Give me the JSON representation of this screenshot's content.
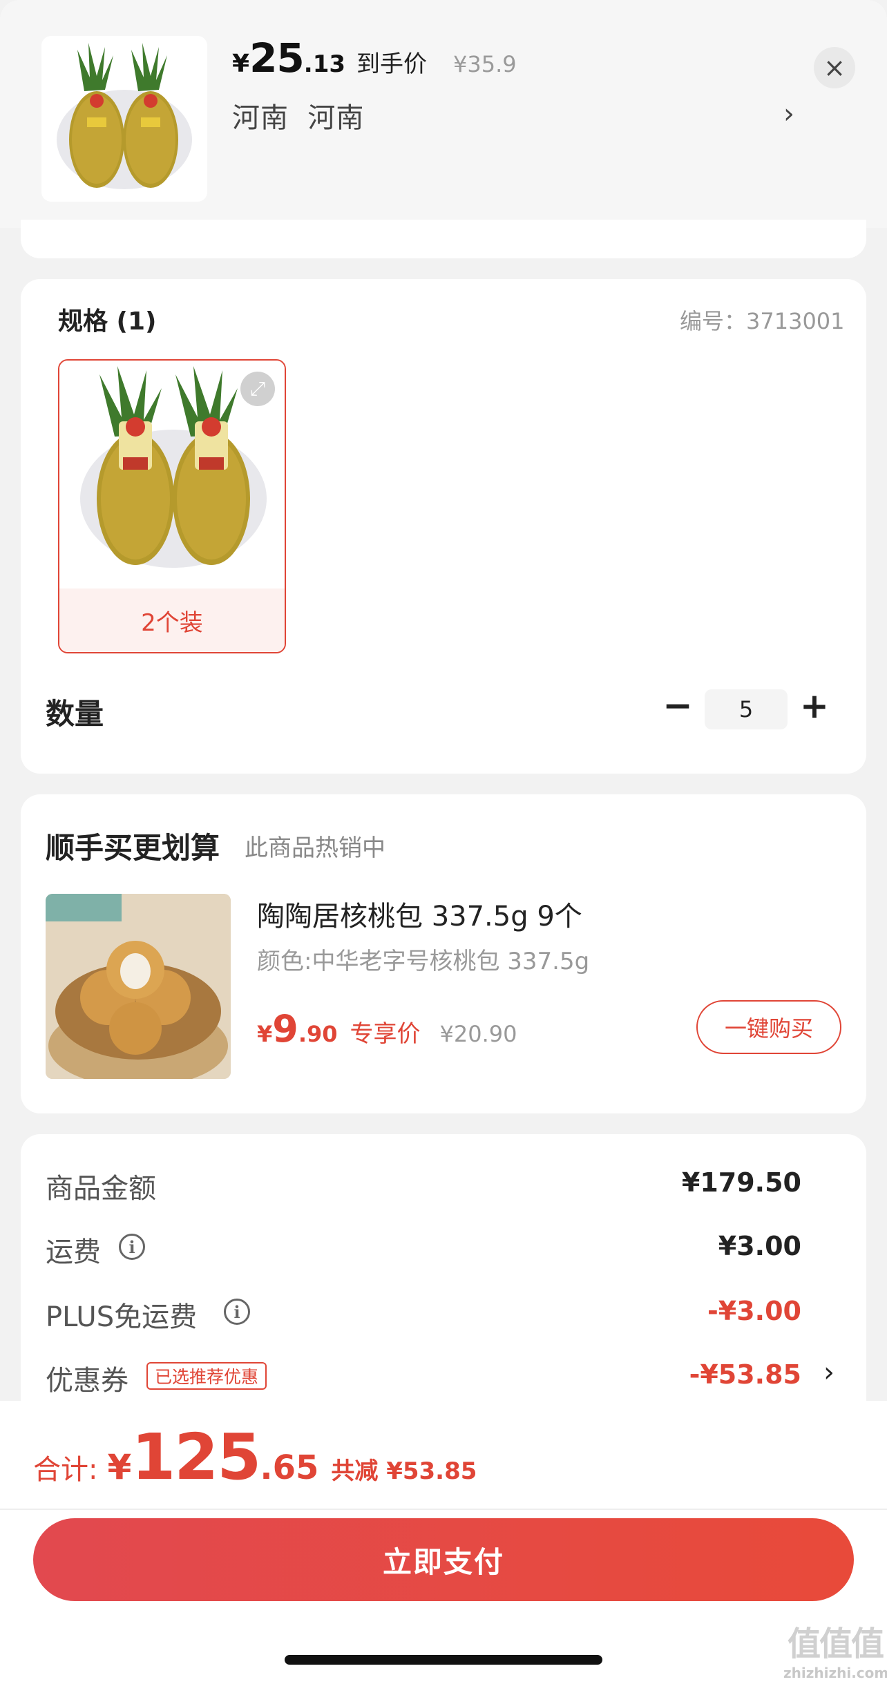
{
  "header": {
    "price_symbol": "¥",
    "price_int": "25",
    "price_dec": ".13",
    "price_tag": "到手价",
    "original_price": "¥35.9",
    "address": "河南  河南",
    "address_chevron": "›",
    "close_symbol": "×"
  },
  "spec": {
    "title": "规格 (1)",
    "code": "编号：3713001",
    "options": [
      {
        "label": "2个装",
        "selected": true
      }
    ]
  },
  "quantity": {
    "label": "数量",
    "minus": "−",
    "value": "5",
    "plus": "+"
  },
  "upsell": {
    "title": "顺手买更划算",
    "subtitle": "此商品热销中",
    "product": {
      "name": "陶陶居核桃包 337.5g 9个",
      "variant": "颜色:中华老字号核桃包 337.5g",
      "price_symbol": "¥",
      "price_int": "9",
      "price_dec": ".90",
      "price_tag": "专享价",
      "original_price": "¥20.90",
      "buy_button": "一键购买"
    }
  },
  "summary": {
    "rows": [
      {
        "label": "商品金额",
        "value": "¥179.50",
        "negative": false
      },
      {
        "label": "运费",
        "value": "¥3.00",
        "negative": false
      },
      {
        "label": "PLUS免运费",
        "value": "-¥3.00",
        "negative": true
      },
      {
        "label": "优惠券",
        "value": "-¥53.85",
        "negative": true,
        "badge": "已选推荐优惠"
      }
    ],
    "info_symbol": "i",
    "coupon_chevron": "›"
  },
  "footer": {
    "total_label": "合计:",
    "total_symbol": "¥",
    "total_int": "125",
    "total_dec": ".65",
    "saved": "共减 ¥53.85",
    "pay_button": "立即支付"
  },
  "watermark": {
    "big": "值值值",
    "small": "zhizhizhi.com"
  },
  "colors": {
    "accent": "#e04536",
    "pay_gradient_start": "#e2494f",
    "pay_gradient_end": "#e84a3a"
  },
  "icons": [
    "close-icon",
    "chevron-right-icon",
    "expand-icon",
    "minus-icon",
    "plus-icon",
    "info-icon"
  ]
}
